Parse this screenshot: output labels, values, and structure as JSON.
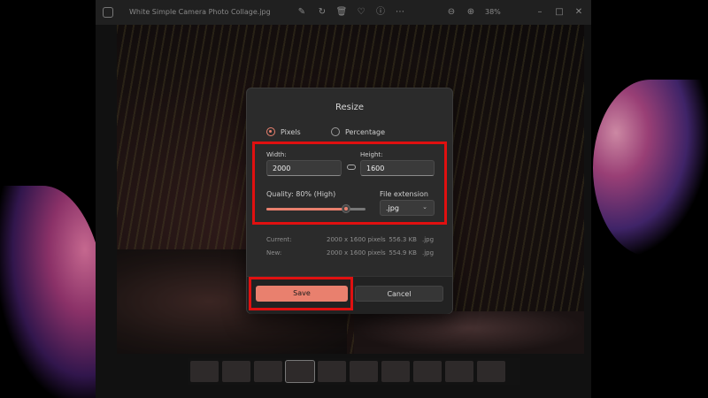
{
  "window": {
    "title": "White Simple Camera Photo Collage.jpg",
    "zoom": "38%"
  },
  "titlebar_icons": [
    "edit-icon",
    "rotate-icon",
    "delete-icon",
    "favorite-icon",
    "info-icon",
    "more-icon",
    "zoom-out-icon",
    "zoom-in-icon",
    "minimize-icon",
    "maximize-icon",
    "close-icon"
  ],
  "dialog": {
    "title": "Resize",
    "mode_options": [
      {
        "label": "Pixels",
        "selected": true
      },
      {
        "label": "Percentage",
        "selected": false
      }
    ],
    "width_label": "Width:",
    "width_value": "2000",
    "height_label": "Height:",
    "height_value": "1600",
    "quality_label": "Quality: 80% (High)",
    "quality_value": 80,
    "file_extension_label": "File extension",
    "file_extension_value": ".jpg",
    "current": {
      "label": "Current:",
      "dimensions": "2000 x 1600 pixels",
      "size": "556.3 KB",
      "ext": ".jpg"
    },
    "new": {
      "label": "New:",
      "dimensions": "2000 x 1600 pixels",
      "size": "554.9 KB",
      "ext": ".jpg"
    },
    "save_label": "Save",
    "cancel_label": "Cancel"
  },
  "colors": {
    "accent": "#e9806e",
    "highlight": "#e01010",
    "dialog_bg": "#2b2b2b"
  }
}
